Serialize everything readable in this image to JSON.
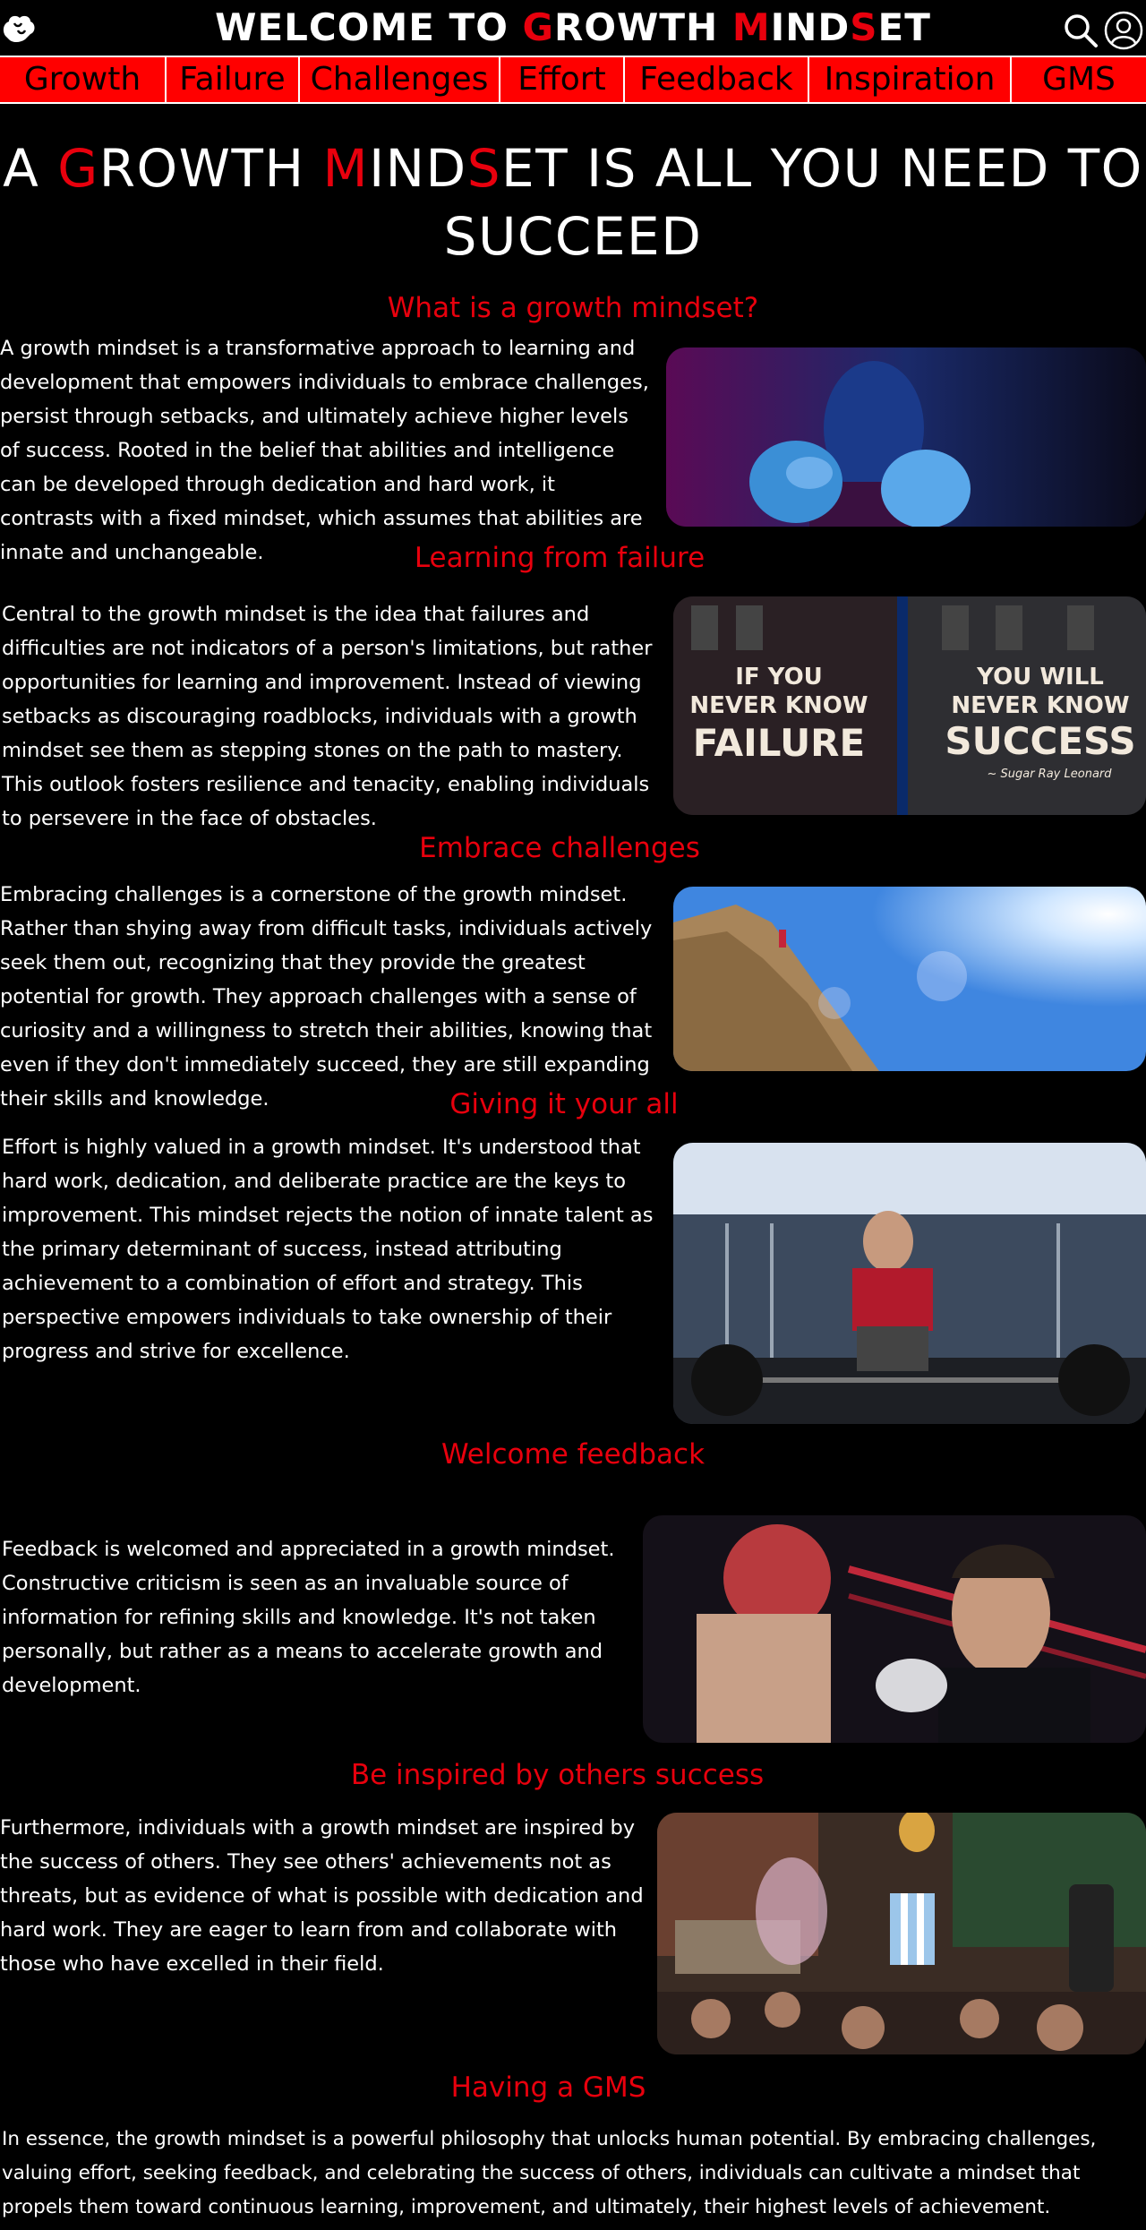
{
  "header": {
    "title_parts": [
      {
        "text": "WELCOME TO ",
        "accent": false
      },
      {
        "text": "G",
        "accent": true
      },
      {
        "text": "ROWTH ",
        "accent": false
      },
      {
        "text": "M",
        "accent": true
      },
      {
        "text": "IND",
        "accent": false
      },
      {
        "text": "S",
        "accent": true
      },
      {
        "text": "ET",
        "accent": false
      }
    ],
    "logo_icon": "brain-flex-icon",
    "search_icon": "search-icon",
    "user_icon": "user-icon"
  },
  "nav": {
    "items": [
      "Growth",
      "Failure",
      "Challenges",
      "Effort",
      "Feedback",
      "Inspiration",
      "GMS"
    ]
  },
  "hero": {
    "title_parts": [
      {
        "text": "A ",
        "accent": false
      },
      {
        "text": "G",
        "accent": true
      },
      {
        "text": "ROWTH ",
        "accent": false
      },
      {
        "text": "M",
        "accent": true
      },
      {
        "text": "IND",
        "accent": false
      },
      {
        "text": "S",
        "accent": true
      },
      {
        "text": "ET IS ALL YOU NEED TO SUCCEED",
        "accent": false
      }
    ]
  },
  "sections": [
    {
      "id": "growth",
      "heading": "What is a growth mindset?",
      "text": "A growth mindset is a transformative approach to learning and development that empowers individuals to embrace challenges, persist through setbacks, and ultimately achieve higher levels of success. Rooted in the belief that abilities and intelligence can be developed through dedication and hard work, it contrasts with a fixed mindset, which assumes that abilities are innate and unchangeable.",
      "image": "boxer-portrait-photo"
    },
    {
      "id": "failure",
      "heading": "Learning from failure",
      "text": "Central to the growth mindset is the idea that failures and difficulties are not indicators of a person's limitations, but rather opportunities for learning and improvement. Instead of viewing setbacks as discouraging roadblocks, individuals with a growth mindset see them as stepping stones on the path to mastery. This outlook fosters resilience and tenacity, enabling individuals to persevere in the face of obstacles.",
      "image": "failure-success-quote-photo",
      "image_text": {
        "left_top": "IF YOU",
        "left_mid": "NEVER KNOW",
        "left_big": "FAILURE",
        "right_top": "YOU WILL",
        "right_mid": "NEVER KNOW",
        "right_big": "SUCCESS",
        "signature": "~ Sugar Ray Leonard"
      }
    },
    {
      "id": "challenges",
      "heading": "Embrace challenges",
      "text": "Embracing challenges is a cornerstone of the growth mindset. Rather than shying away from difficult tasks, individuals actively seek them out, recognizing that they provide the greatest potential for growth. They approach challenges with a sense of curiosity and a willingness to stretch their abilities, knowing that even if they don't immediately succeed, they are still expanding their skills and knowledge.",
      "image": "rock-climber-photo"
    },
    {
      "id": "effort",
      "heading": "Giving it your all",
      "text": "Effort is highly valued in a growth mindset. It's understood that hard work, dedication, and deliberate practice are the keys to improvement. This mindset rejects the notion of innate talent as the primary determinant of success, instead attributing achievement to a combination of effort and strategy. This perspective empowers individuals to take ownership of their progress and strive for excellence.",
      "image": "deadlift-gym-photo"
    },
    {
      "id": "feedback",
      "heading": "Welcome feedback",
      "text": "Feedback is welcomed and appreciated in a growth mindset. Constructive criticism is seen as an invaluable source of information for refining skills and knowledge. It's not taken personally, but rather as a means to accelerate growth and development.",
      "image": "boxing-coach-photo"
    },
    {
      "id": "inspiration",
      "heading": "Be inspired by others success",
      "text": "Furthermore, individuals with a growth mindset are inspired by the success of others. They see others' achievements not as threats, but as evidence of what is possible with dedication and hard work. They are eager to learn from and collaborate with those who have excelled in their field.",
      "image": "trophy-celebration-photo"
    },
    {
      "id": "gms",
      "heading": "Having a GMS",
      "text": "In essence, the growth mindset is a powerful philosophy that unlocks human potential. By embracing challenges, valuing effort, seeking feedback, and celebrating the success of others, individuals can cultivate a mindset that propels them toward continuous learning, improvement, and ultimately, their highest levels of achievement."
    }
  ],
  "colors": {
    "accent": "#e8000d",
    "nav_background": "#ff0000",
    "page_background": "#000000",
    "text": "#ffffff"
  }
}
